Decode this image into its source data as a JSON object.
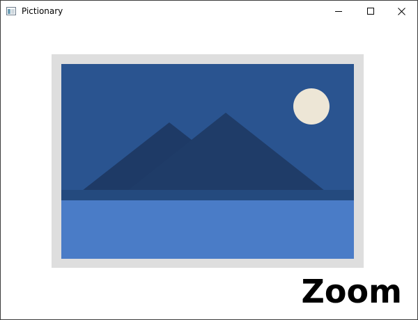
{
  "window": {
    "title": "Pictionary",
    "icon": "window-app-icon",
    "controls": {
      "minimize_icon": "minimize-icon",
      "maximize_icon": "maximize-icon",
      "close_icon": "close-icon"
    }
  },
  "main": {
    "image": {
      "icon": "image-placeholder-icon",
      "colors": {
        "frame": "#dedede",
        "sky": "#2a5490",
        "mountain_back": "#1e3a66",
        "mountain_front": "#1f3c68",
        "shoreline": "#244a7e",
        "water": "#4a7cc7",
        "moon": "#ede6d6"
      }
    },
    "zoom_label": "Zoom"
  }
}
